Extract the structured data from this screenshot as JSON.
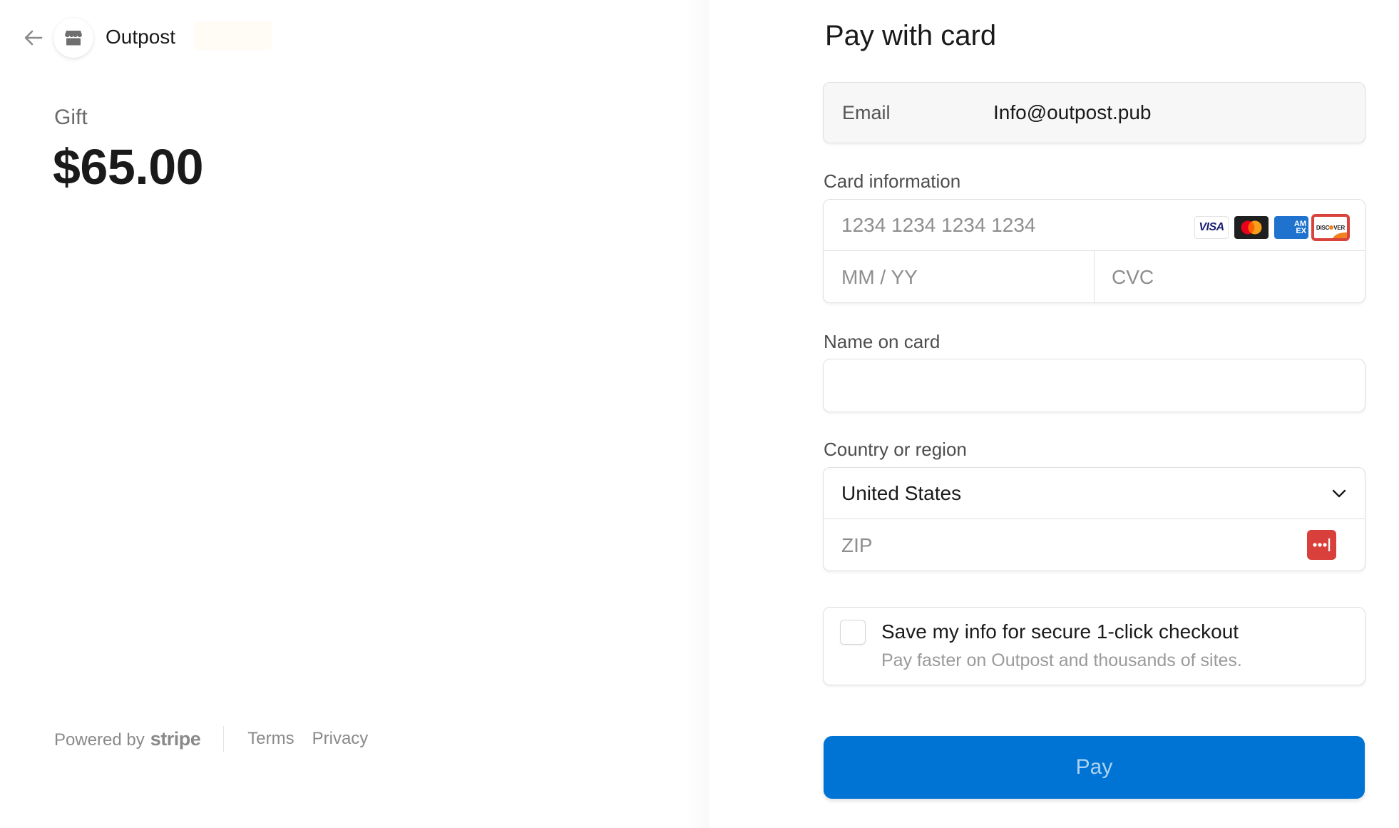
{
  "header": {
    "back_icon": "arrow-left-icon",
    "merchant_logo_icon": "storefront-icon",
    "merchant_name": "Outpost"
  },
  "product": {
    "name": "Gift",
    "price": "$65.00"
  },
  "footer": {
    "powered_by": "Powered by",
    "brand": "stripe",
    "links": [
      {
        "label": "Terms"
      },
      {
        "label": "Privacy"
      }
    ]
  },
  "form": {
    "title": "Pay with card",
    "email": {
      "label": "Email",
      "value": "Info@outpost.pub"
    },
    "card": {
      "label": "Card information",
      "number_placeholder": "1234 1234 1234 1234",
      "expiry_placeholder": "MM / YY",
      "cvc_placeholder": "CVC",
      "brands": [
        {
          "name": "Visa",
          "text": "VISA",
          "icon": "visa-icon"
        },
        {
          "name": "Mastercard",
          "icon": "mastercard-icon"
        },
        {
          "name": "American Express",
          "text": "AM EX",
          "icon": "amex-icon"
        },
        {
          "name": "Discover",
          "text": "DISC VER",
          "icon": "discover-icon"
        }
      ]
    },
    "name_on_card": {
      "label": "Name on card",
      "value": ""
    },
    "country": {
      "label": "Country or region",
      "selected": "United States",
      "zip_placeholder": "ZIP",
      "password_manager_icon": "password-manager-icon"
    },
    "save_info": {
      "checked": false,
      "title": "Save my info for secure 1-click checkout",
      "subtitle": "Pay faster on Outpost and thousands of sites."
    },
    "pay_button": {
      "label": "Pay"
    }
  },
  "colors": {
    "accent": "#0074d4",
    "password_manager": "#d93f3b",
    "discover_highlight": "#d9433b"
  }
}
